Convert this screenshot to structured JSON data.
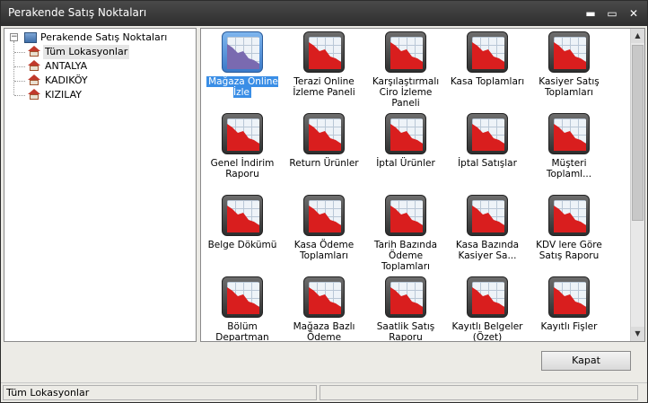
{
  "window": {
    "title": "Perakende Satış Noktaları"
  },
  "tree": {
    "root_label": "Perakende Satış Noktaları",
    "items": [
      {
        "label": "Tüm Lokasyonlar"
      },
      {
        "label": "ANTALYA"
      },
      {
        "label": "KADIKÖY"
      },
      {
        "label": "KIZILAY"
      }
    ]
  },
  "tiles": [
    {
      "label": "Mağaza Online İzle"
    },
    {
      "label": "Terazi Online İzleme Paneli"
    },
    {
      "label": "Karşılaştırmalı Ciro İzleme Paneli"
    },
    {
      "label": "Kasa Toplamları"
    },
    {
      "label": "Kasiyer Satış Toplamları"
    },
    {
      "label": "Genel İndirim Raporu"
    },
    {
      "label": "Return Ürünler"
    },
    {
      "label": "İptal Ürünler"
    },
    {
      "label": "İptal Satışlar"
    },
    {
      "label": "Müşteri Toplaml..."
    },
    {
      "label": "Belge Dökümü"
    },
    {
      "label": "Kasa Ödeme Toplamları"
    },
    {
      "label": "Tarih Bazında Ödeme Toplamları"
    },
    {
      "label": "Kasa Bazında Kasiyer Sa..."
    },
    {
      "label": "KDV lere Göre Satış Raporu"
    },
    {
      "label": "Bölüm Departman Satışları"
    },
    {
      "label": "Mağaza Bazlı Ödeme Toplamları"
    },
    {
      "label": "Saatlik Satış Raporu"
    },
    {
      "label": "Kayıtlı Belgeler (Özet)"
    },
    {
      "label": "Kayıtlı Fişler"
    }
  ],
  "footer": {
    "close_label": "Kapat"
  },
  "status": {
    "location": "Tüm Lokasyonlar",
    "secondary": ""
  },
  "colors": {
    "titlebar": "#2e2e2e",
    "selection": "#3a8ee6",
    "chart_red": "#d91e1e"
  }
}
